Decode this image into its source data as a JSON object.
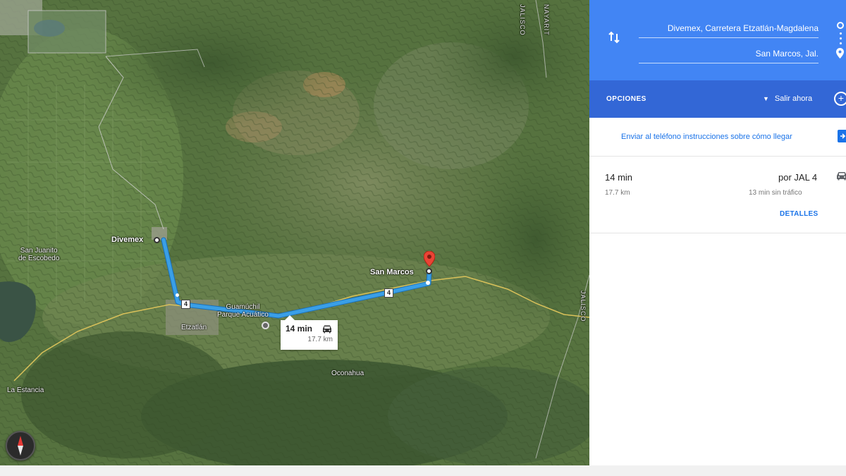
{
  "map": {
    "places": {
      "divemex": "Divemex",
      "san_marcos": "San Marcos",
      "san_juanito_line1": "San Juanito",
      "san_juanito_line2": "de Escobedo",
      "etzatlan": "Etzatlán",
      "guamuchil_line1": "Guamúchil",
      "guamuchil_line2": "Parque Acuático",
      "oconahua": "Oconahua",
      "la_estancia": "La Estancia",
      "jalisco_top": "JALISCO",
      "nayarit": "NAYARIT",
      "jalisco_right": "JALISCO"
    },
    "route_shields": [
      "4",
      "4"
    ],
    "route_box": {
      "time": "14 min",
      "distance": "17.7 km",
      "mode_icon": "car-icon"
    },
    "compass_icon": "compass-icon",
    "colors": {
      "route": "#3a9fe6",
      "route_outline": "#1b6fb8",
      "destination_marker": "#ea4335",
      "road": "#d9c15a"
    }
  },
  "panel": {
    "origin": "Divemex, Carretera Etzatlán-Magdalena",
    "destination": "San Marcos, Jal.",
    "options_label": "OPCIONES",
    "depart_label": "Salir ahora",
    "add_stop_icon": "add-circle-icon",
    "send_link": "Enviar al teléfono instrucciones sobre cómo llegar",
    "trip": {
      "via": "por JAL 4",
      "time": "14 min",
      "traffic_note": "13 min sin tráfico",
      "distance": "17.7 km",
      "details_label": "DETALLES"
    },
    "colors": {
      "header": "#4285f4",
      "options_bar": "#3367d6",
      "link": "#1a73e8"
    }
  }
}
